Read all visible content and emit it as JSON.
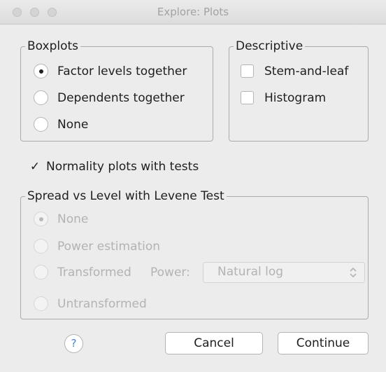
{
  "window": {
    "title": "Explore: Plots"
  },
  "boxplots": {
    "legend": "Boxplots",
    "options": [
      {
        "label": "Factor levels together",
        "selected": true
      },
      {
        "label": "Dependents together",
        "selected": false
      },
      {
        "label": "None",
        "selected": false
      }
    ]
  },
  "descriptive": {
    "legend": "Descriptive",
    "options": [
      {
        "label": "Stem-and-leaf",
        "checked": false
      },
      {
        "label": "Histogram",
        "checked": false
      }
    ]
  },
  "normality": {
    "label": "Normality plots with tests",
    "checked": true
  },
  "spread": {
    "legend": "Spread vs Level with Levene Test",
    "options": [
      {
        "label": "None",
        "selected": true
      },
      {
        "label": "Power estimation",
        "selected": false
      },
      {
        "label": "Transformed",
        "selected": false
      },
      {
        "label": "Untransformed",
        "selected": false
      }
    ],
    "power_label": "Power:",
    "power_value": "Natural log"
  },
  "footer": {
    "help_label": "?",
    "cancel_label": "Cancel",
    "continue_label": "Continue"
  }
}
